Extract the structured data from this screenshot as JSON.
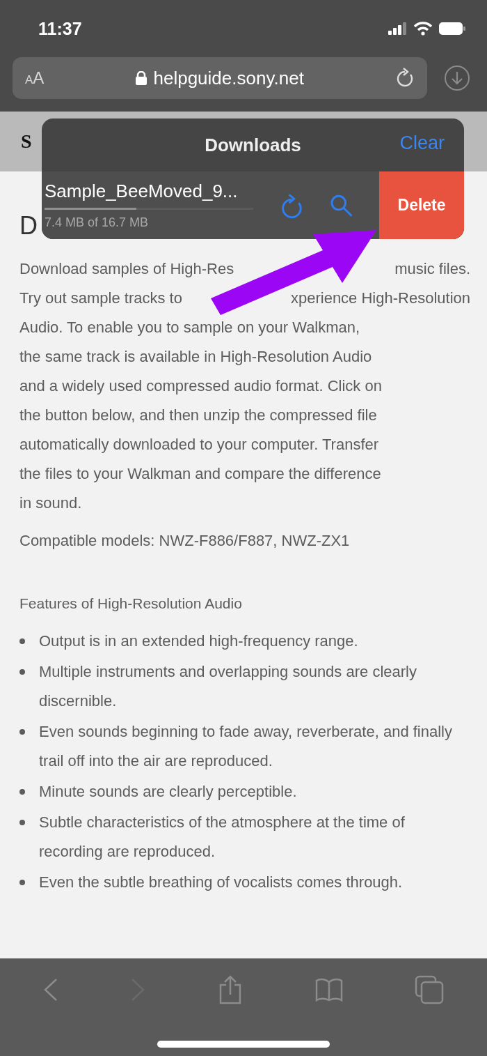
{
  "status_bar": {
    "time": "11:37"
  },
  "address_bar": {
    "text_size_button": "AA",
    "url": "helpguide.sony.net"
  },
  "page": {
    "logo_fragment": "S",
    "heading_fragment": "D",
    "intro_lines": [
      [
        "Download samples of High-Res",
        "music files."
      ],
      [
        "Try out sample tracks to",
        "xperience High-Resolution"
      ],
      [
        "Audio. To enable you to sample on your Walkman,"
      ],
      [
        "the same track is available in High-Resolution Audio"
      ],
      [
        "and a widely used compressed audio format. Click on"
      ],
      [
        "the button below, and then unzip the compressed file"
      ],
      [
        "automatically downloaded to your computer. Transfer"
      ],
      [
        "the files to your Walkman and compare the difference"
      ],
      [
        "in sound."
      ]
    ],
    "paragraphs": [
      "Compatible models: NWZ-F886/F887, NWZ-ZX1"
    ],
    "subheading": "Features of High-Resolution Audio",
    "bullets": [
      "Output is in an extended high-frequency range.",
      "Multiple instruments and overlapping sounds are clearly discernible.",
      "Even sounds beginning to fade away, reverberate, and finally trail off into the air are reproduced.",
      "Minute sounds are clearly perceptible.",
      "Subtle characteristics of the atmosphere at the time of recording are reproduced.",
      "Even the subtle breathing of vocalists comes through."
    ]
  },
  "downloads": {
    "title": "Downloads",
    "clear": "Clear",
    "items": [
      {
        "name": "Sample_BeeMoved_9...",
        "progress": "7.4 MB of 16.7 MB",
        "level": 0.44,
        "delete": "Delete"
      }
    ]
  },
  "toolbar": [
    {
      "kind": "back",
      "disabled": false
    },
    {
      "kind": "forward",
      "disabled": true
    },
    {
      "kind": "share",
      "disabled": false
    },
    {
      "kind": "bookmarks",
      "disabled": false
    },
    {
      "kind": "tabs",
      "disabled": false
    }
  ]
}
